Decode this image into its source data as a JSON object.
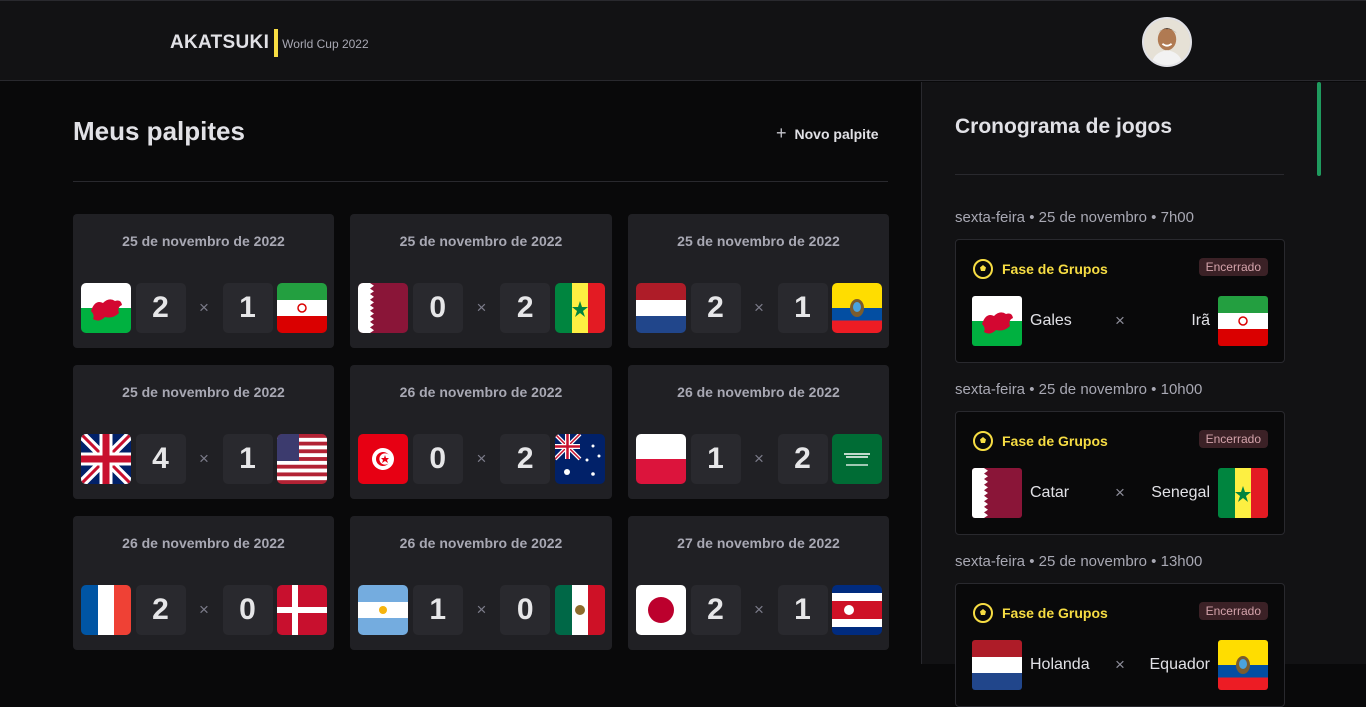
{
  "header": {
    "logo": "AKATSUKI",
    "subtitle": "World Cup 2022"
  },
  "main": {
    "title": "Meus palpites",
    "new_button": "Novo palpite",
    "cards": [
      {
        "date": "25 de novembro de 2022",
        "home": "wales-flag",
        "home_score": "2",
        "away_score": "1",
        "away": "iran-flag"
      },
      {
        "date": "25 de novembro de 2022",
        "home": "qatar-flag",
        "home_score": "0",
        "away_score": "2",
        "away": "senegal-flag"
      },
      {
        "date": "25 de novembro de 2022",
        "home": "netherlands-flag",
        "home_score": "2",
        "away_score": "1",
        "away": "ecuador-flag"
      },
      {
        "date": "25 de novembro de 2022",
        "home": "england-uk-flag",
        "home_score": "4",
        "away_score": "1",
        "away": "usa-flag"
      },
      {
        "date": "26 de novembro de 2022",
        "home": "tunisia-flag",
        "home_score": "0",
        "away_score": "2",
        "away": "australia-flag"
      },
      {
        "date": "26 de novembro de 2022",
        "home": "poland-flag",
        "home_score": "1",
        "away_score": "2",
        "away": "saudi-arabia-flag"
      },
      {
        "date": "26 de novembro de 2022",
        "home": "france-flag",
        "home_score": "2",
        "away_score": "0",
        "away": "denmark-flag"
      },
      {
        "date": "26 de novembro de 2022",
        "home": "argentina-flag",
        "home_score": "1",
        "away_score": "0",
        "away": "mexico-flag"
      },
      {
        "date": "27 de novembro de 2022",
        "home": "japan-flag",
        "home_score": "2",
        "away_score": "1",
        "away": "costa-rica-flag"
      }
    ]
  },
  "sidebar": {
    "title": "Cronograma de jogos",
    "slots": [
      {
        "time": "sexta-feira • 25 de novembro • 7h00",
        "phase": "Fase de Grupos",
        "status": "Encerrado",
        "home": "Gales",
        "away": "Irã"
      },
      {
        "time": "sexta-feira • 25 de novembro • 10h00",
        "phase": "Fase de Grupos",
        "status": "Encerrado",
        "home": "Catar",
        "away": "Senegal"
      },
      {
        "time": "sexta-feira • 25 de novembro • 13h00",
        "phase": "Fase de Grupos",
        "status": "Encerrado",
        "home": "Holanda",
        "away": "Equador"
      }
    ]
  },
  "colors": {
    "accent": "#f7dd43",
    "scroll": "#1f9a5e",
    "card": "#202024"
  },
  "symbols": {
    "times": "×",
    "plus": "+"
  }
}
